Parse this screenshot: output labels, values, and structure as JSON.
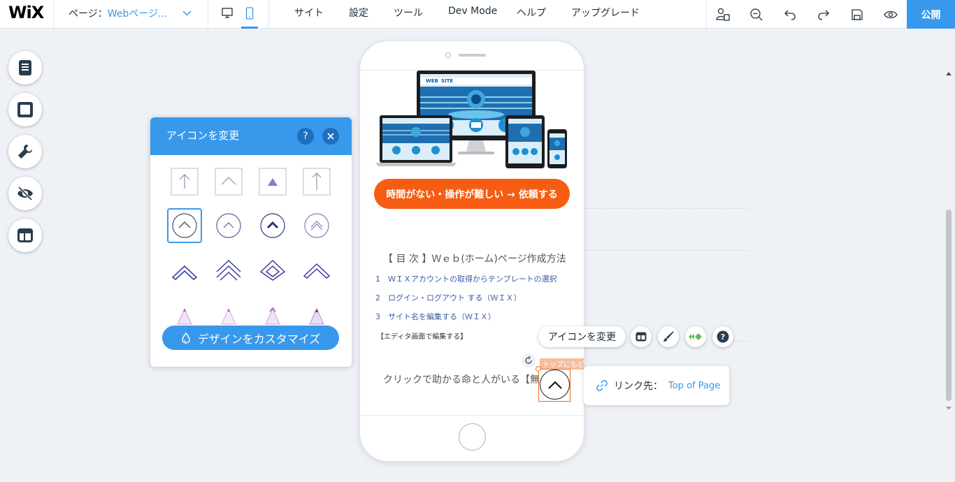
{
  "topbar": {
    "logo": "WiX",
    "page_label": "ページ：",
    "page_value": "Webページ...",
    "menu": [
      "サイト",
      "設定",
      "ツール",
      "Dev Mode",
      "ヘルプ",
      "アップグレード"
    ],
    "publish": "公開"
  },
  "phone": {
    "cta": "時間がない・操作が難しい → 依頼する",
    "toc_title": "【 目 次 】Ｗｅｂ(ホーム)ページ作成方法",
    "toc_items": [
      "1　ＷＩＸアカウントの取得からテンプレートの選択",
      "2　ログイン・ログアウト する（ＷＩＸ）",
      "3　サイト名を編集する（ＷＩＸ）"
    ],
    "editor_note": "【エディタ画面で編集する】",
    "save_text": "クリックで助かる命と人がいる【無料",
    "anchor_tag": "トップにもどる"
  },
  "icon_panel": {
    "title": "アイコンを変更",
    "help": "?",
    "customize": "デザインをカスタマイズ"
  },
  "floating_toolbar": {
    "change_icon": "アイコンを変更"
  },
  "link_tooltip": {
    "label": "リンク先：",
    "value": "Top of Page"
  },
  "colors": {
    "accent": "#3899ec",
    "cta": "#f65d12",
    "selection": "#f06a22"
  }
}
